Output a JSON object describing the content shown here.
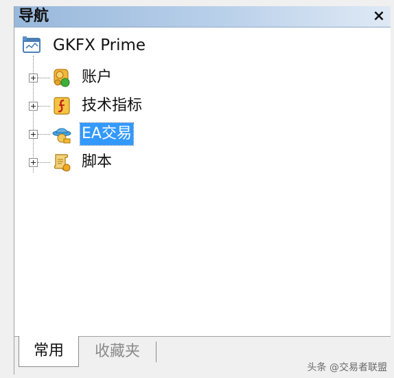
{
  "window": {
    "title": "导航",
    "close_label": "×"
  },
  "tree": {
    "root": {
      "label": "GKFX Prime",
      "icon": "terminal-icon"
    },
    "items": [
      {
        "label": "账户",
        "icon": "accounts-icon",
        "selected": false
      },
      {
        "label": "技术指标",
        "icon": "indicators-icon",
        "selected": false
      },
      {
        "label": "EA交易",
        "icon": "expert-advisor-icon",
        "selected": true
      },
      {
        "label": "脚本",
        "icon": "scripts-icon",
        "selected": false
      }
    ]
  },
  "tabs": [
    {
      "label": "常用",
      "active": true
    },
    {
      "label": "收藏夹",
      "active": false
    }
  ],
  "watermark": "头条 @交易者联盟",
  "colors": {
    "selection": "#3399ff",
    "title_bar": "#b9d0ea"
  }
}
